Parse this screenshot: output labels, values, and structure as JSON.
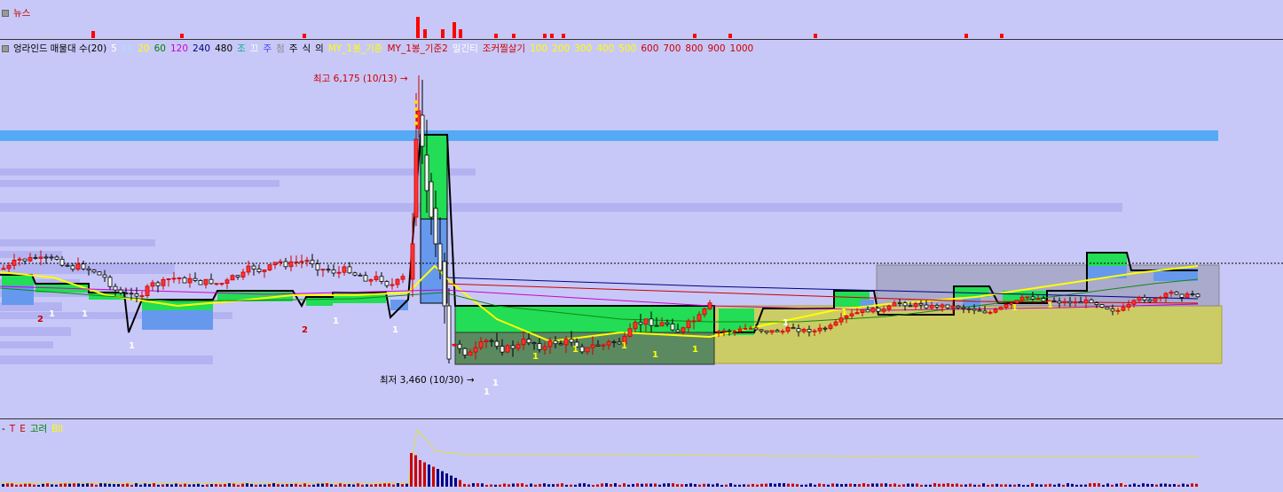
{
  "news_panel": {
    "title": "뉴스",
    "color": "#ff0000",
    "bars": [
      [
        103,
        8
      ],
      [
        203,
        5
      ],
      [
        341,
        5
      ],
      [
        469,
        24
      ],
      [
        477,
        10
      ],
      [
        497,
        10
      ],
      [
        510,
        18
      ],
      [
        517,
        10
      ],
      [
        557,
        5
      ],
      [
        577,
        5
      ],
      [
        612,
        5
      ],
      [
        620,
        5
      ],
      [
        633,
        5
      ],
      [
        781,
        5
      ],
      [
        821,
        5
      ],
      [
        917,
        5
      ],
      [
        1087,
        5
      ],
      [
        1127,
        5
      ]
    ]
  },
  "price_legend": {
    "items": [
      {
        "text": "매물대 수(20)",
        "color": "#000000"
      },
      {
        "text": "5",
        "color": "#ffffff"
      },
      {
        "text": "10",
        "color": "#aaddff"
      },
      {
        "text": "20",
        "color": "#ffff00"
      },
      {
        "text": "60",
        "color": "#008000"
      },
      {
        "text": "120",
        "color": "#cc00cc"
      },
      {
        "text": "240",
        "color": "#000080"
      },
      {
        "text": "480",
        "color": "#000000"
      },
      {
        "text": "조",
        "color": "#00aa88"
      },
      {
        "text": "끄",
        "color": "#ffffff"
      },
      {
        "text": "주",
        "color": "#4444ff"
      },
      {
        "text": "첨",
        "color": "#888888"
      },
      {
        "text": "주",
        "color": "#000000"
      },
      {
        "text": "식",
        "color": "#000000"
      },
      {
        "text": "의",
        "color": "#000000"
      },
      {
        "text": "MY_1봉_기준",
        "color": "#ffff00"
      },
      {
        "text": "MY_1봉_기준2",
        "color": "#cc0000"
      },
      {
        "text": "밀긴티",
        "color": "#ffffff"
      },
      {
        "text": "조커찔살기",
        "color": "#cc0000"
      },
      {
        "text": "100",
        "color": "#ffff00"
      },
      {
        "text": "200",
        "color": "#ffff00"
      },
      {
        "text": "300",
        "color": "#ffff00"
      },
      {
        "text": "400",
        "color": "#ffff00"
      },
      {
        "text": "500",
        "color": "#ffff00"
      },
      {
        "text": "600",
        "color": "#cc0000"
      },
      {
        "text": "700",
        "color": "#cc0000"
      },
      {
        "text": "800",
        "color": "#cc0000"
      },
      {
        "text": "900",
        "color": "#cc0000"
      },
      {
        "text": "1000",
        "color": "#cc0000"
      }
    ],
    "prefix": "엉라인드"
  },
  "chart_data": {
    "type": "candlestick",
    "title": "",
    "annotations": {
      "high_label": "최고 6,175 (10/13)",
      "low_label": "최저 3,460 (10/30)"
    },
    "high": 6175,
    "low": 3460,
    "series": [
      {
        "name": "20",
        "color": "#ffff00"
      },
      {
        "name": "60",
        "color": "#008000"
      },
      {
        "name": "120",
        "color": "#cc00cc"
      },
      {
        "name": "240",
        "color": "#000080"
      }
    ],
    "markers": [
      {
        "text": "2",
        "color": "#cc0000"
      },
      {
        "text": "1",
        "color": "#ffffff"
      },
      {
        "text": "1",
        "color": "#ffffff"
      },
      {
        "text": "1",
        "color": "#ffffff"
      },
      {
        "text": "2",
        "color": "#cc0000"
      },
      {
        "text": "1",
        "color": "#ffffff"
      },
      {
        "text": "1",
        "color": "#ffffff"
      },
      {
        "text": "1",
        "color": "#ffffff"
      },
      {
        "text": "1",
        "color": "#ffffff"
      },
      {
        "text": "1",
        "color": "#ffff00"
      },
      {
        "text": "1",
        "color": "#ffff00"
      },
      {
        "text": "1",
        "color": "#ffff00"
      },
      {
        "text": "1",
        "color": "#ffff00"
      },
      {
        "text": "1",
        "color": "#ffff00"
      },
      {
        "text": "1",
        "color": "#ffffff"
      },
      {
        "text": "1",
        "color": "#ffff00"
      },
      {
        "text": "1",
        "color": "#ffff00"
      },
      {
        "text": "1",
        "color": "#ffff00"
      }
    ]
  },
  "volume_legend": {
    "items": [
      {
        "text": "-",
        "color": "#000000"
      },
      {
        "text": "T",
        "color": "#cc0000"
      },
      {
        "text": "E",
        "color": "#cc0000"
      },
      {
        "text": "고려",
        "color": "#008800"
      },
      {
        "text": "Bll",
        "color": "#ffff00"
      }
    ]
  }
}
